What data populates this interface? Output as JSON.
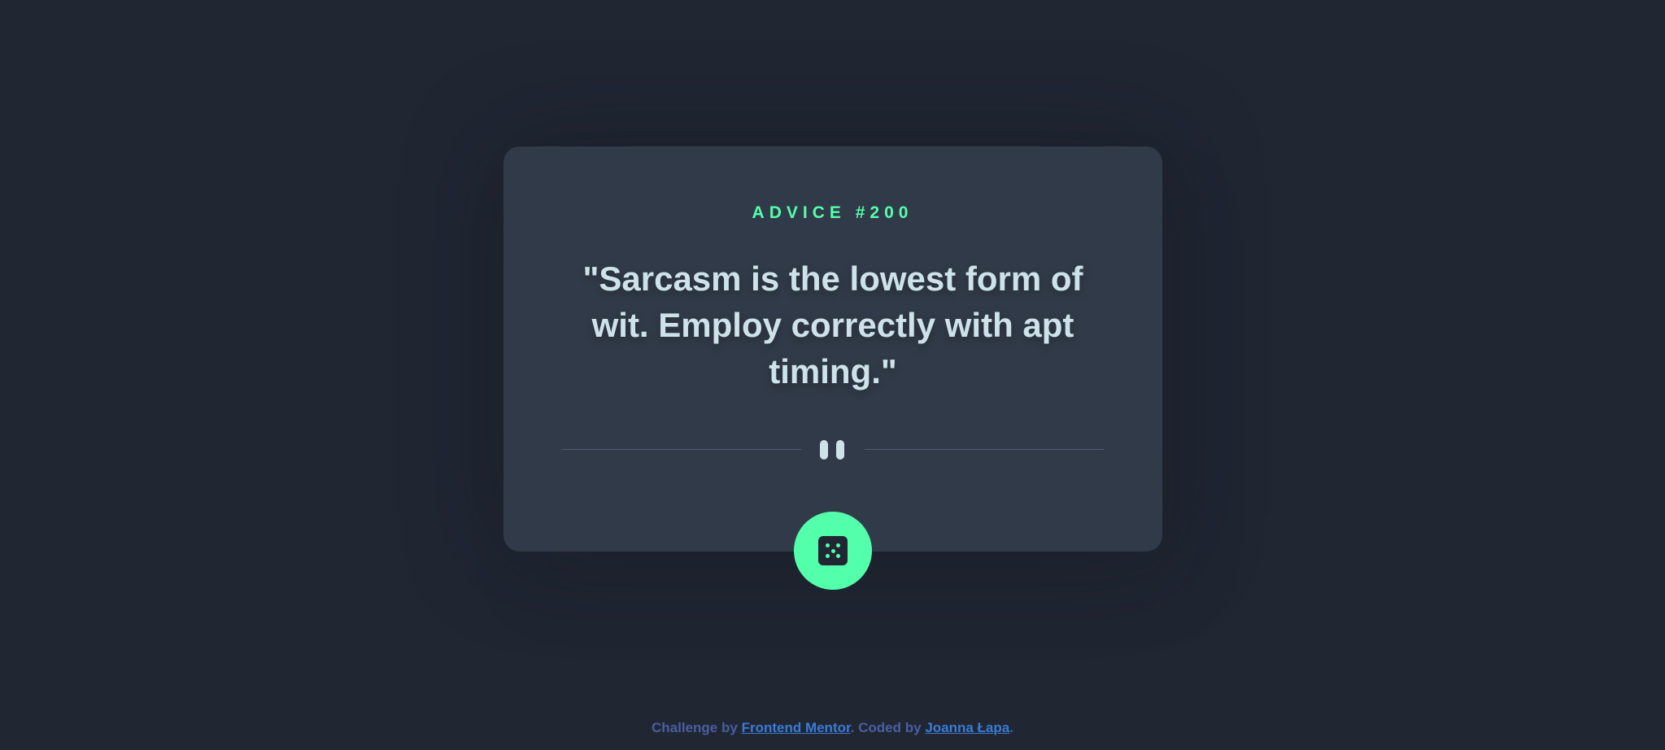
{
  "card": {
    "advice_id": "ADVICE #200",
    "quote": "\"Sarcasm is the lowest form of wit. Employ correctly with apt timing.\""
  },
  "divider": {
    "icon": "pause-icon"
  },
  "dice_button": {
    "icon": "dice-icon"
  },
  "footer": {
    "prefix": "Challenge by",
    "link1": "Frontend Mentor",
    "middle": ". Coded by",
    "link2": "Joanna Łapa",
    "suffix": "."
  },
  "colors": {
    "background": "#202632",
    "card": "#313a48",
    "accent": "#53ffab",
    "text": "#cee3e9",
    "divider": "#4f5d74",
    "footer_text": "#4a5fa3",
    "footer_link": "#3a7bd5"
  }
}
